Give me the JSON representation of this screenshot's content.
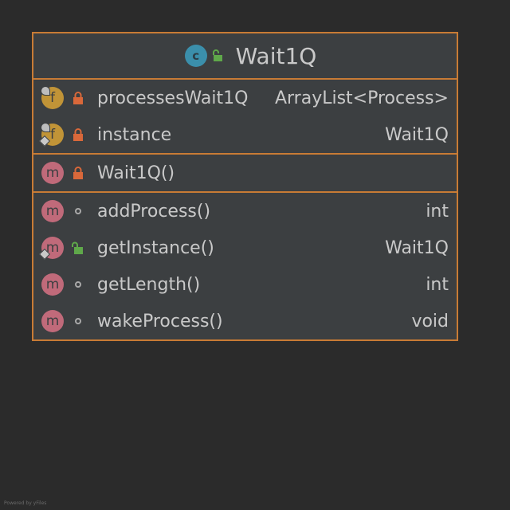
{
  "class": {
    "name": "Wait1Q",
    "kind_letter": "c"
  },
  "fields": [
    {
      "kind_letter": "f",
      "name": "processesWait1Q",
      "type": "ArrayList<Process>",
      "visibility": "private",
      "modifier": "final"
    },
    {
      "kind_letter": "f",
      "name": "instance",
      "type": "Wait1Q",
      "visibility": "private",
      "modifier": "static"
    }
  ],
  "constructors": [
    {
      "kind_letter": "m",
      "name": "Wait1Q()",
      "type": "",
      "visibility": "private"
    }
  ],
  "methods": [
    {
      "kind_letter": "m",
      "name": "addProcess()",
      "type": "int",
      "visibility": "package"
    },
    {
      "kind_letter": "m",
      "name": "getInstance()",
      "type": "Wait1Q",
      "visibility": "public",
      "modifier": "static"
    },
    {
      "kind_letter": "m",
      "name": "getLength()",
      "type": "int",
      "visibility": "package"
    },
    {
      "kind_letter": "m",
      "name": "wakeProcess()",
      "type": "void",
      "visibility": "package"
    }
  ],
  "footer": "Powered by yFiles",
  "colors": {
    "background": "#2b2b2b",
    "box": "#3c3f41",
    "border": "#c87b35",
    "class_icon": "#3b8fab",
    "field_icon": "#c19437",
    "method_icon": "#c06a7a",
    "private_lock": "#d9683a",
    "public_lock": "#5fa84a",
    "text": "#c9c9c9"
  },
  "icons": {
    "private": "lock-closed-icon",
    "public": "lock-open-icon",
    "package": "circle-dot-icon"
  }
}
